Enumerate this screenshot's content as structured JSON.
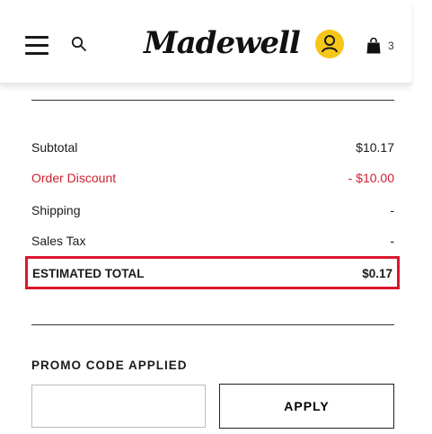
{
  "header": {
    "brand": "Madewell",
    "bag_count": "3",
    "accent_color": "#f5c518"
  },
  "summary": {
    "subtotal_label": "Subtotal",
    "subtotal_value": "$10.17",
    "discount_label": "Order Discount",
    "discount_value": "- $10.00",
    "shipping_label": "Shipping",
    "shipping_value": "-",
    "tax_label": "Sales Tax",
    "tax_value": "-",
    "total_label": "ESTIMATED TOTAL",
    "total_value": "$0.17",
    "discount_color": "#d0202f",
    "highlight_color": "#d9182f"
  },
  "promo": {
    "title": "PROMO CODE APPLIED",
    "input_value": "",
    "apply_label": "APPLY"
  }
}
